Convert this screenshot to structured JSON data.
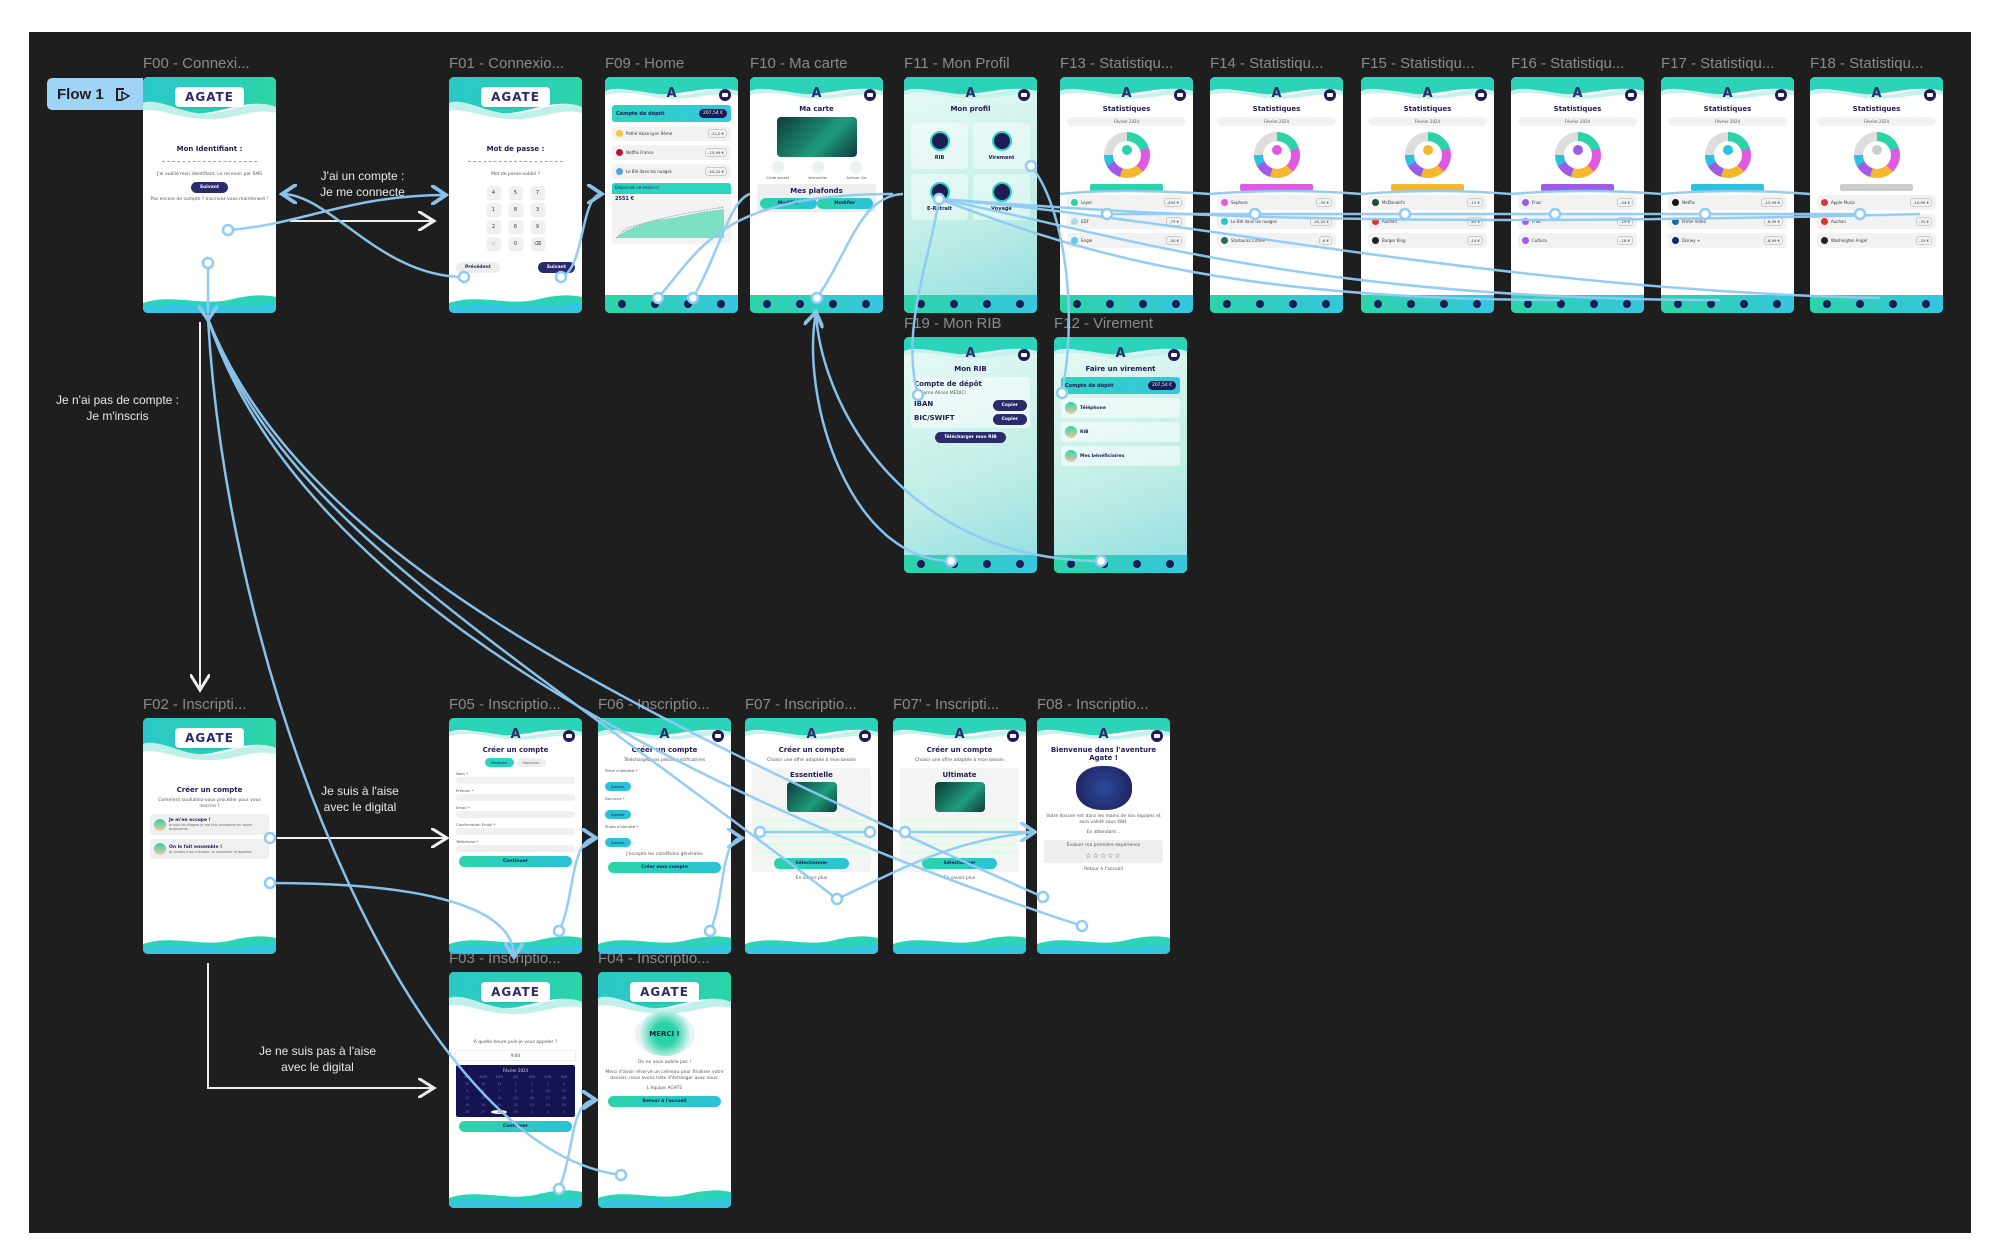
{
  "flow": {
    "label": "Flow 1",
    "icon": "play-icon"
  },
  "annotations": {
    "login": [
      "J'ai un compte :",
      "Je me connecte"
    ],
    "signup": [
      "Je n'ai pas de compte :",
      "Je m'inscris"
    ],
    "digital": [
      "Je suis à l'aise",
      "avec le digital"
    ],
    "nodigital": [
      "Je ne suis pas à l'aise",
      "avec le digital"
    ]
  },
  "colors": {
    "canvas": "#1e1e1e",
    "connector": "#8ecbf5",
    "teal": "#2bd4c0",
    "navy": "#1e1b55",
    "badge": "#9fd4f7"
  },
  "frames": [
    {
      "id": "F00",
      "label": "F00  - Connexi...",
      "header": "logo",
      "logo": "AGATE",
      "blocks": [
        {
          "t": "h",
          "text": "Mon Identifiant :"
        },
        {
          "t": "dashes"
        },
        {
          "t": "text",
          "text": "J'ai oublié mon identifiant, Le recevoir par SMS"
        },
        {
          "t": "btn",
          "style": "dark",
          "text": "Suivant"
        },
        {
          "t": "text",
          "text": "Pas encore de compte ? Inscrivez-vous maintenant !"
        }
      ]
    },
    {
      "id": "F01",
      "label": "F01 - Connexio...",
      "header": "logo",
      "logo": "AGATE",
      "blocks": [
        {
          "t": "h",
          "text": "Mot de passe :"
        },
        {
          "t": "dashes"
        },
        {
          "t": "text",
          "text": "Mot de passe oublié ?"
        },
        {
          "t": "keypad",
          "keys": [
            "4",
            "5",
            "7",
            "1",
            "8",
            "3",
            "2",
            "6",
            "9",
            "⁙",
            "0",
            "⌫"
          ]
        },
        {
          "t": "btnrow",
          "items": [
            {
              "style": "light",
              "text": "Précédent"
            },
            {
              "style": "dark",
              "text": "Suivant"
            }
          ]
        }
      ]
    },
    {
      "id": "F09",
      "label": "F09 - Home",
      "header": "mark",
      "nav": true,
      "blocks": [
        {
          "t": "balance",
          "name": "Compte de dépôt",
          "amount": "207,54 €"
        },
        {
          "t": "row",
          "color": "#f4c542",
          "name": "Pathé Vaise Lyon 9ème",
          "amount": "-12,0 €"
        },
        {
          "t": "row",
          "color": "#c0152f",
          "name": "Netflix France",
          "amount": "-15,99 €"
        },
        {
          "t": "row",
          "color": "#5aa0d8",
          "name": "Le Blé dans les nuages",
          "amount": "-20,20 €"
        },
        {
          "t": "chart",
          "title": "Dépensé ce mois-ci",
          "value": "2551 €"
        }
      ]
    },
    {
      "id": "F10",
      "label": "F10 - Ma carte",
      "header": "mark",
      "nav": true,
      "blocks": [
        {
          "t": "h",
          "text": "Ma carte"
        },
        {
          "t": "card"
        },
        {
          "t": "icons3",
          "items": [
            "Code secret",
            "Verrouiller",
            "Activer Vis"
          ]
        },
        {
          "t": "box",
          "title": "Mes plafonds",
          "buttons": [
            "Modifier",
            "Modifier"
          ]
        }
      ]
    },
    {
      "id": "F11",
      "label": "F11 - Mon Profil",
      "header": "mark",
      "tint": true,
      "nav": true,
      "blocks": [
        {
          "t": "h",
          "text": "Mon profil"
        },
        {
          "t": "tiles",
          "items": [
            "RIB",
            "Virement",
            "E-Retrait",
            "Voyage"
          ]
        }
      ]
    },
    {
      "id": "F13",
      "label": "F13 - Statistiqu...",
      "header": "mark",
      "nav": true,
      "blocks": [
        {
          "t": "h",
          "text": "Statistiques"
        },
        {
          "t": "month",
          "text": "Février 2024"
        },
        {
          "t": "donut",
          "color": "#2bd4a8"
        },
        {
          "t": "pill",
          "color": "#2bd4a8"
        },
        {
          "t": "row",
          "color": "#2bd4a8",
          "name": "Loyer",
          "amount": "-450 €"
        },
        {
          "t": "row",
          "color": "#aadbe8",
          "name": "EDF",
          "amount": "-75 €"
        },
        {
          "t": "row",
          "color": "#5ec8e6",
          "name": "Engie",
          "amount": "-40 €"
        }
      ]
    },
    {
      "id": "F14",
      "label": "F14 - Statistiqu...",
      "header": "mark",
      "nav": true,
      "blocks": [
        {
          "t": "h",
          "text": "Statistiques"
        },
        {
          "t": "month",
          "text": "Février 2024"
        },
        {
          "t": "donut",
          "color": "#e05ae0"
        },
        {
          "t": "pill",
          "color": "#e05ae0"
        },
        {
          "t": "row",
          "color": "#e05ae0",
          "name": "Sephora",
          "amount": "-35 €"
        },
        {
          "t": "row",
          "color": "#2bc2d6",
          "name": "Le Blé dans les nuages",
          "amount": "-20,20 €"
        },
        {
          "t": "row",
          "color": "#2d6b4d",
          "name": "Starbucks Coffee",
          "amount": "-6 €"
        }
      ]
    },
    {
      "id": "F15",
      "label": "F15 - Statistiqu...",
      "header": "mark",
      "nav": true,
      "blocks": [
        {
          "t": "h",
          "text": "Statistiques"
        },
        {
          "t": "month",
          "text": "Février 2024"
        },
        {
          "t": "donut",
          "color": "#f4b72e"
        },
        {
          "t": "pill",
          "color": "#f4b72e"
        },
        {
          "t": "row",
          "color": "#1e4a2e",
          "name": "McDonald's",
          "amount": "-12 €"
        },
        {
          "t": "row",
          "color": "#e03030",
          "name": "Auchan",
          "amount": "-65 €"
        },
        {
          "t": "row",
          "color": "#222",
          "name": "Burger King",
          "amount": "-14 €"
        }
      ]
    },
    {
      "id": "F16",
      "label": "F16 - Statistiqu...",
      "header": "mark",
      "nav": true,
      "blocks": [
        {
          "t": "h",
          "text": "Statistiques"
        },
        {
          "t": "month",
          "text": "Février 2024"
        },
        {
          "t": "donut",
          "color": "#a05ae8"
        },
        {
          "t": "pill",
          "color": "#a05ae8"
        },
        {
          "t": "row",
          "color": "#a05ae8",
          "name": "Fnac",
          "amount": "-34 €"
        },
        {
          "t": "row",
          "color": "#a05ae8",
          "name": "Fnac",
          "amount": "-29 €"
        },
        {
          "t": "row",
          "color": "#a05ae8",
          "name": "Cultura",
          "amount": "-18 €"
        }
      ]
    },
    {
      "id": "F17",
      "label": "F17 - Statistiqu...",
      "header": "mark",
      "nav": true,
      "blocks": [
        {
          "t": "h",
          "text": "Statistiques"
        },
        {
          "t": "month",
          "text": "Février 2024"
        },
        {
          "t": "donut",
          "color": "#2bc2e0"
        },
        {
          "t": "pill",
          "color": "#2bc2e0"
        },
        {
          "t": "row",
          "color": "#111",
          "name": "Netflix",
          "amount": "-15,99 €"
        },
        {
          "t": "row",
          "color": "#1a6b9b",
          "name": "Prime Video",
          "amount": "-6,99 €"
        },
        {
          "t": "row",
          "color": "#0e2a6b",
          "name": "Disney +",
          "amount": "-8,99 €"
        }
      ]
    },
    {
      "id": "F18",
      "label": "F18 - Statistiqu...",
      "header": "mark",
      "nav": true,
      "blocks": [
        {
          "t": "h",
          "text": "Statistiques"
        },
        {
          "t": "month",
          "text": "Février 2024"
        },
        {
          "t": "donut",
          "color": "#cccccc"
        },
        {
          "t": "pill",
          "color": "#cccccc"
        },
        {
          "t": "row",
          "color": "#e03040",
          "name": "Apple Music",
          "amount": "-10,99 €"
        },
        {
          "t": "row",
          "color": "#e03030",
          "name": "Auchan",
          "amount": "-32 €"
        },
        {
          "t": "row",
          "color": "#222",
          "name": "Washington Angel",
          "amount": "-25 €"
        }
      ]
    },
    {
      "id": "F19",
      "label": "F19 - Mon RIB",
      "header": "mark",
      "tint": true,
      "nav": true,
      "blocks": [
        {
          "t": "h",
          "text": "Mon RIB"
        },
        {
          "t": "rib",
          "title": "Compte de dépôt",
          "holder": "Madame Alison MEDICI",
          "fields": [
            "IBAN",
            "BIC/SWIFT"
          ],
          "copy": "Copier"
        },
        {
          "t": "btn",
          "style": "dark",
          "text": "Télécharger mon RIB"
        }
      ]
    },
    {
      "id": "F12",
      "label": "F12 - Virement",
      "header": "mark",
      "tint": true,
      "nav": true,
      "blocks": [
        {
          "t": "h",
          "text": "Faire un virement"
        },
        {
          "t": "balance",
          "name": "Compte de dépôt",
          "amount": "207,54 €"
        },
        {
          "t": "choice",
          "text": "Téléphone"
        },
        {
          "t": "choice",
          "text": "RIB"
        },
        {
          "t": "choice",
          "text": "Mes bénéficiaires"
        }
      ]
    },
    {
      "id": "F02",
      "label": "F02 -  Inscripti...",
      "header": "logo",
      "logo": "AGATE",
      "blocks": [
        {
          "t": "h",
          "text": "Créer un compte"
        },
        {
          "t": "text",
          "text": "Comment souhaitez-vous procéder pour vous inscrire ?"
        },
        {
          "t": "option",
          "title": "Je m'en occupe !",
          "desc": "Je suis les étapes je me fais connecter en toute autonomie."
        },
        {
          "t": "option",
          "title": "On le fait ensemble !",
          "desc": "Je choisis mon créneau un conseiller m'appelle."
        }
      ]
    },
    {
      "id": "F05",
      "label": "F05 - Inscriptio...",
      "header": "mark",
      "blocks": [
        {
          "t": "h",
          "text": "Créer un compte"
        },
        {
          "t": "tabs",
          "items": [
            "Madame",
            "Monsieur"
          ]
        },
        {
          "t": "input",
          "label": "Nom *"
        },
        {
          "t": "input",
          "label": "Prénom *"
        },
        {
          "t": "input",
          "label": "Email *"
        },
        {
          "t": "input",
          "label": "Confirmation Email *"
        },
        {
          "t": "input",
          "label": "Téléphone *"
        },
        {
          "t": "btn",
          "style": "teal",
          "text": "Continuer"
        }
      ]
    },
    {
      "id": "F06",
      "label": "F06 - Inscriptio...",
      "header": "mark",
      "blocks": [
        {
          "t": "h",
          "text": "Créer un compte"
        },
        {
          "t": "text",
          "text": "Téléchargez vos pièces justificatives"
        },
        {
          "t": "chipfield",
          "label": "Pièce d'identité *",
          "chip": "Ajouter"
        },
        {
          "t": "chipfield",
          "label": "Domicile *",
          "chip": "Ajouter"
        },
        {
          "t": "chipfield",
          "label": "Photo d'identité *",
          "chip": "Ajouter"
        },
        {
          "t": "text",
          "text": "J'accepte les conditions générales"
        },
        {
          "t": "btn",
          "style": "teal",
          "text": "Créer mon compte"
        }
      ]
    },
    {
      "id": "F07",
      "label": "F07 - Inscriptio...",
      "header": "mark",
      "blocks": [
        {
          "t": "h",
          "text": "Créer un compte"
        },
        {
          "t": "text",
          "text": "Choisir une offre adaptée à mon besoin"
        },
        {
          "t": "offer",
          "title": "Essentielle",
          "button": "Sélectionner"
        },
        {
          "t": "text",
          "text": "En savoir plus"
        }
      ]
    },
    {
      "id": "F07b",
      "label": "F07' - Inscripti...",
      "header": "mark",
      "blocks": [
        {
          "t": "h",
          "text": "Créer un compte"
        },
        {
          "t": "text",
          "text": "Choisir une offre adaptée à mon besoin"
        },
        {
          "t": "offer",
          "title": "Ultimate",
          "button": "Sélectionner"
        },
        {
          "t": "text",
          "text": "En savoir plus"
        }
      ]
    },
    {
      "id": "F08",
      "label": "F08 - Inscriptio...",
      "header": "mark",
      "blocks": [
        {
          "t": "h",
          "text": "Bienvenue dans l'aventure Agate !"
        },
        {
          "t": "illus"
        },
        {
          "t": "text",
          "text": "Votre dossier est dans les mains de nos équipes et sera validé sous 48H."
        },
        {
          "t": "text",
          "text": "En attendant..."
        },
        {
          "t": "rate",
          "title": "Évaluer ma première expérience",
          "stars": "☆☆☆☆☆"
        },
        {
          "t": "text",
          "text": "Retour à l'accueil"
        }
      ]
    },
    {
      "id": "F03",
      "label": "F03 - Inscriptio...",
      "header": "logo",
      "logo": "AGATE",
      "blocks": [
        {
          "t": "text",
          "text": "À quelle heure puis-je vous appeler ?"
        },
        {
          "t": "select",
          "value": "9:00"
        },
        {
          "t": "cal",
          "month": "Février 2024",
          "days": [
            "LUN",
            "MAR",
            "MER",
            "JEU",
            "VEN",
            "SAM",
            "DIM",
            "29",
            "30",
            "31",
            "1",
            "2",
            "3",
            "4",
            "5",
            "6",
            "7",
            "8",
            "9",
            "10",
            "11",
            "12",
            "13",
            "14",
            "15",
            "16",
            "17",
            "18",
            "19",
            "20",
            "21",
            "22",
            "23",
            "24",
            "25",
            "26",
            "27",
            "28",
            "29",
            "1",
            "2",
            "3"
          ],
          "selected": "28"
        },
        {
          "t": "btn",
          "style": "teal",
          "text": "Confirmer"
        }
      ]
    },
    {
      "id": "F04",
      "label": "F04 - Inscriptio...",
      "header": "logo",
      "logo": "AGATE",
      "blocks": [
        {
          "t": "merci",
          "text": "MERCI !"
        },
        {
          "t": "text",
          "text": "On ne vous oublie pas !"
        },
        {
          "t": "text",
          "text": "Merci d'avoir réservé un créneau pour finaliser votre dossier, nous avons hâte d'échanger avec vous."
        },
        {
          "t": "text",
          "text": "L'équipe AGATE"
        },
        {
          "t": "btn",
          "style": "teal",
          "text": "Retour à l'accueil"
        }
      ]
    }
  ]
}
